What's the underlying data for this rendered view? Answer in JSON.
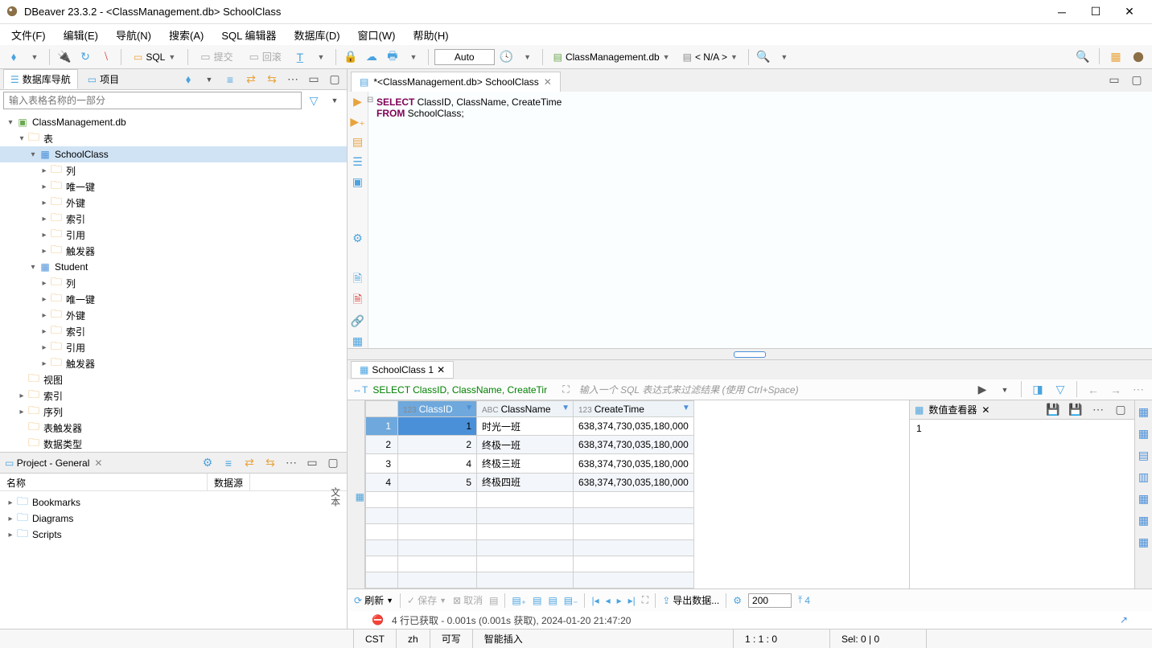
{
  "title": "DBeaver 23.3.2 - <ClassManagement.db> SchoolClass",
  "menu": [
    "文件(F)",
    "编辑(E)",
    "导航(N)",
    "搜索(A)",
    "SQL 编辑器",
    "数据库(D)",
    "窗口(W)",
    "帮助(H)"
  ],
  "toolbar": {
    "sql": "SQL",
    "commit": "提交",
    "rollback": "回滚",
    "auto": "Auto",
    "db": "ClassManagement.db",
    "na": "< N/A >"
  },
  "nav": {
    "tab1": "数据库导航",
    "tab2": "项目",
    "filter_ph": "输入表格名称的一部分",
    "db": "ClassManagement.db",
    "tables": "表",
    "t1": "SchoolClass",
    "t2": "Student",
    "sub": [
      "列",
      "唯一键",
      "外键",
      "索引",
      "引用",
      "触发器"
    ],
    "views": "视图",
    "indexes": "索引",
    "seq": "序列",
    "tabletrig": "表触发器",
    "datatype": "数据类型"
  },
  "project": {
    "title": "Project - General",
    "col1": "名称",
    "col2": "数据源",
    "items": [
      "Bookmarks",
      "Diagrams",
      "Scripts"
    ]
  },
  "editor": {
    "tab": "*<ClassManagement.db> SchoolClass",
    "line1_kw1": "SELECT",
    "line1_rest": " ClassID, ClassName, CreateTime",
    "line2_kw": "FROM",
    "line2_rest": " SchoolClass;"
  },
  "result": {
    "tab": "SchoolClass 1",
    "sql": "SELECT ClassID, ClassName, CreateTir",
    "filter_ph": "输入一个 SQL 表达式来过滤结果 (使用 Ctrl+Space)",
    "cols": [
      "ClassID",
      "ClassName",
      "CreateTime"
    ],
    "rows": [
      {
        "n": "1",
        "id": "1",
        "name": "时光一班",
        "ct": "638,374,730,035,180,000"
      },
      {
        "n": "2",
        "id": "2",
        "name": "终极一班",
        "ct": "638,374,730,035,180,000"
      },
      {
        "n": "3",
        "id": "4",
        "name": "终极三班",
        "ct": "638,374,730,035,180,000"
      },
      {
        "n": "4",
        "id": "5",
        "name": "终极四班",
        "ct": "638,374,730,035,180,000"
      }
    ],
    "value_viewer": "数值查看器",
    "value": "1",
    "refresh": "刷新",
    "save": "保存",
    "cancel": "取消",
    "export": "导出数据...",
    "page": "200",
    "rows_n": "4",
    "status": "4 行已获取 - 0.001s (0.001s 获取), 2024-01-20 21:47:20"
  },
  "statusbar": {
    "tz": "CST",
    "lang": "zh",
    "rw": "可写",
    "ins": "智能插入",
    "pos": "1 : 1 : 0",
    "sel": "Sel: 0 | 0"
  }
}
